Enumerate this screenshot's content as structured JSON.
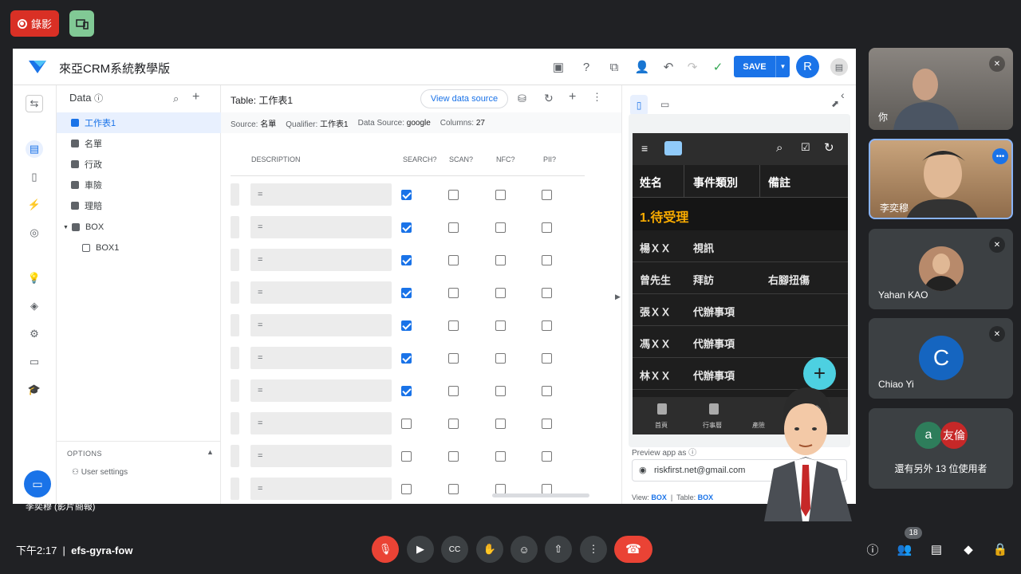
{
  "meet": {
    "record_label": "錄影",
    "clock": "下午2:17",
    "meeting_code": "efs-gyra-fow",
    "people_count": "18",
    "presenter_caption": "李奕穆 (影片簡報)"
  },
  "appsheet": {
    "app_title": "來亞CRM系統教學版",
    "save_label": "SAVE",
    "avatar_letter": "R",
    "data_header": "Data",
    "tree": [
      {
        "label": "工作表1",
        "selected": true
      },
      {
        "label": "名單"
      },
      {
        "label": "行政"
      },
      {
        "label": "車險"
      },
      {
        "label": "理賠"
      },
      {
        "label": "BOX"
      },
      {
        "label": "BOX1"
      }
    ],
    "options_label": "OPTIONS",
    "user_settings_label": "User settings",
    "table_title": "Table: 工作表1",
    "view_data_source": "View data source",
    "source": {
      "source_label": "Source:",
      "source_value": "名單",
      "qualifier_label": "Qualifier:",
      "qualifier_value": "工作表1",
      "datasource_label": "Data Source:",
      "datasource_value": "google",
      "columns_label": "Columns:",
      "columns_value": "27"
    },
    "columns": [
      "DESCRIPTION",
      "SEARCH?",
      "SCAN?",
      "NFC?",
      "PII?"
    ],
    "rows": [
      {
        "desc": "=",
        "search": true,
        "scan": false,
        "nfc": false,
        "pii": false
      },
      {
        "desc": "=",
        "search": true,
        "scan": false,
        "nfc": false,
        "pii": false
      },
      {
        "desc": "=",
        "search": true,
        "scan": false,
        "nfc": false,
        "pii": false
      },
      {
        "desc": "=",
        "search": true,
        "scan": false,
        "nfc": false,
        "pii": false
      },
      {
        "desc": "=",
        "search": true,
        "scan": false,
        "nfc": false,
        "pii": false
      },
      {
        "desc": "=",
        "search": true,
        "scan": false,
        "nfc": false,
        "pii": false
      },
      {
        "desc": "=",
        "search": true,
        "scan": false,
        "nfc": false,
        "pii": false
      },
      {
        "desc": "=",
        "search": false,
        "scan": false,
        "nfc": false,
        "pii": false
      },
      {
        "desc": "=",
        "search": false,
        "scan": false,
        "nfc": false,
        "pii": false
      },
      {
        "desc": "=",
        "search": false,
        "scan": false,
        "nfc": false,
        "pii": false
      }
    ],
    "preview": {
      "headers": [
        "姓名",
        "事件類別",
        "備註"
      ],
      "group": "1.待受理",
      "rows": [
        {
          "name": "楊ＸＸ",
          "type": "視訊",
          "note": ""
        },
        {
          "name": "曾先生",
          "type": "拜訪",
          "note": "右腳扭傷"
        },
        {
          "name": "張ＸＸ",
          "type": "代辦事項",
          "note": ""
        },
        {
          "name": "馮ＸＸ",
          "type": "代辦事項",
          "note": ""
        },
        {
          "name": "林ＸＸ",
          "type": "代辦事項",
          "note": ""
        }
      ],
      "tabs": [
        "首頁",
        "行事曆",
        "產險",
        "故障"
      ],
      "preview_as_label": "Preview app as",
      "email": "riskfirst.net@gmail.com",
      "view_label": "View:",
      "view_value": "BOX",
      "table_label": "Table:",
      "table_value": "BOX"
    }
  },
  "participants": [
    {
      "name": "你"
    },
    {
      "name": "李奕穆"
    },
    {
      "name": "Yahan KAO"
    },
    {
      "name": "Chiao Yi",
      "initial": "C"
    },
    {
      "others_label": "還有另外 13 位使用者",
      "a1": "a",
      "a2": "友倫"
    }
  ]
}
